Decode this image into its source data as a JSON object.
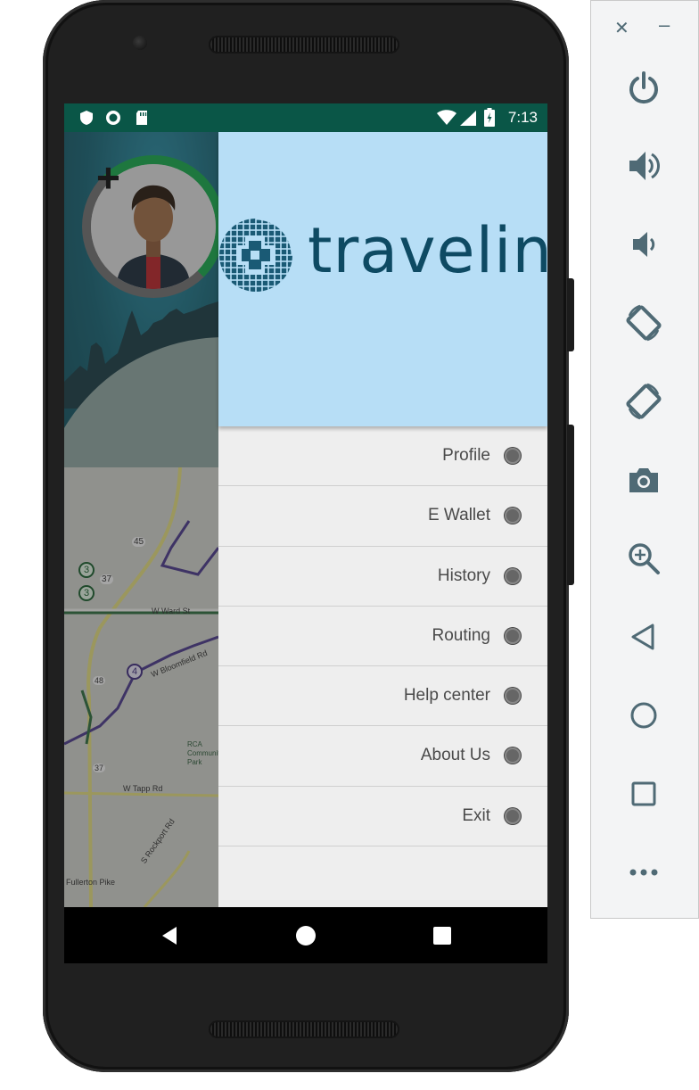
{
  "status_bar": {
    "time": "7:13",
    "icons": [
      "shield-icon",
      "circle-status-icon",
      "sd-card-icon",
      "wifi-icon",
      "signal-icon",
      "battery-icon"
    ]
  },
  "drawer": {
    "logo_text": "travelink",
    "menu": [
      {
        "label": "Profile"
      },
      {
        "label": "E Wallet"
      },
      {
        "label": "History"
      },
      {
        "label": "Routing"
      },
      {
        "label": "Help center"
      },
      {
        "label": "About Us"
      },
      {
        "label": "Exit"
      }
    ]
  },
  "map_labels": [
    "45",
    "37",
    "3",
    "3",
    "4",
    "48",
    "37",
    "W Tapp Rd",
    "S Rockport Rd",
    "W Ward St",
    "W Bloomfield Rd",
    "Fullerton Pike",
    "RCA Community Park"
  ],
  "nav_bar": {
    "buttons": [
      "back-icon",
      "home-icon",
      "recents-icon"
    ]
  },
  "emulator_toolbar": {
    "controls": [
      "close-icon",
      "minimize-icon"
    ],
    "buttons": [
      "power-icon",
      "volume-up-icon",
      "volume-down-icon",
      "rotate-left-icon",
      "rotate-right-icon",
      "camera-icon",
      "zoom-icon",
      "back-icon",
      "home-icon",
      "overview-icon",
      "more-icon"
    ]
  },
  "colors": {
    "status_bar": "#0a5647",
    "drawer_header": "#b7def6",
    "drawer_bg": "#eeeeee",
    "logo": "#0e4a63",
    "toolbar_icon": "#4f6a75"
  }
}
